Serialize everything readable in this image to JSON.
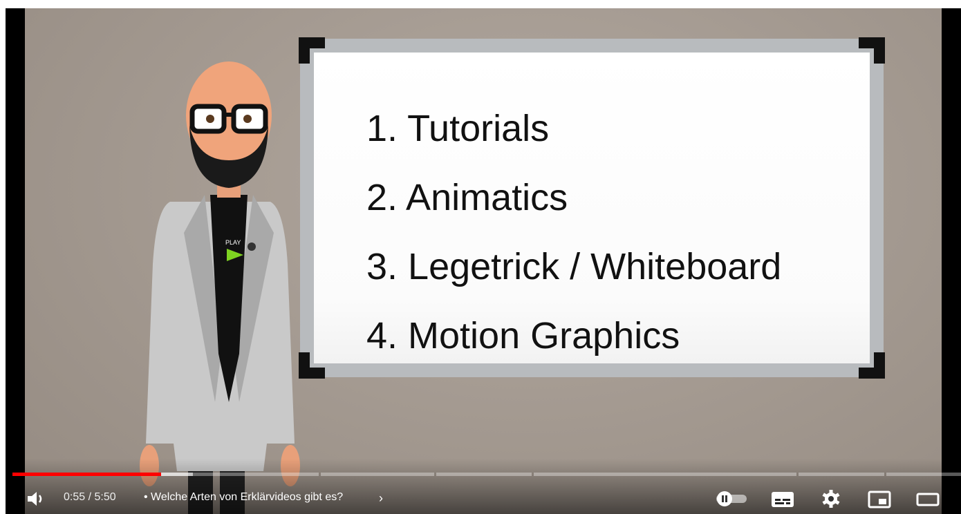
{
  "whiteboard": {
    "items": [
      "1. Tutorials",
      "2. Animatics",
      "3. Legetrick / Whiteboard",
      "4. Motion Graphics"
    ]
  },
  "presenter": {
    "shirt_text": "PLAY"
  },
  "player": {
    "time_current": "0:55",
    "time_total": "5:50",
    "time_display": "0:55 / 5:50",
    "chapter_title": "• Welche Arten von Erklärvideos gibt es?",
    "chapter_chevron": "›",
    "progress_fraction": 0.157,
    "buffer_fraction": 0.19,
    "accent_color": "#ff0000",
    "icons": [
      "volume-icon",
      "autoplay-toggle-icon",
      "subtitles-icon",
      "settings-gear-icon",
      "miniplayer-icon",
      "theater-mode-icon"
    ]
  }
}
